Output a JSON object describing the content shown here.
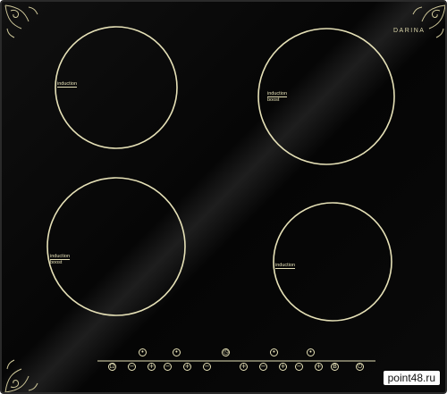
{
  "brand": {
    "name": "DARINA"
  },
  "zones": [
    {
      "id": "front-left-top",
      "labels": [
        "induction"
      ]
    },
    {
      "id": "top-right",
      "labels": [
        "induction",
        "boost"
      ]
    },
    {
      "id": "bottom-left",
      "labels": [
        "induction",
        "boost"
      ]
    },
    {
      "id": "bottom-right",
      "labels": [
        "induction"
      ]
    }
  ],
  "controls": {
    "symbols": {
      "plus": "+",
      "minus": "−",
      "power": "⏻",
      "lock": "⊡",
      "timer": "◷"
    }
  },
  "watermark": {
    "text": "point48.ru"
  },
  "colors": {
    "glass": "#080808",
    "ink": "#e6e1b7",
    "frame": "#2a2a2a"
  }
}
